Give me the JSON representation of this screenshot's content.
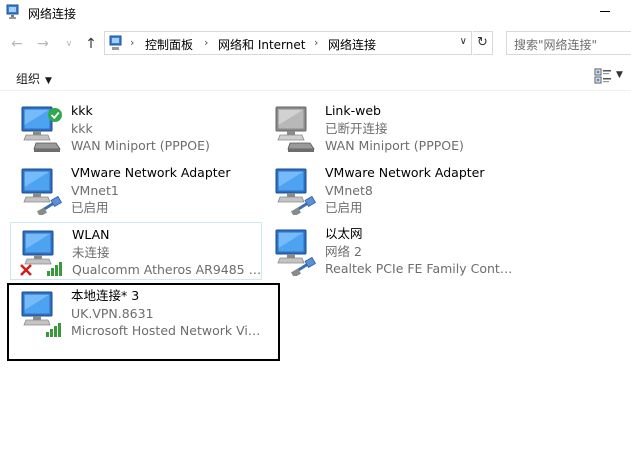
{
  "window": {
    "title": "网络连接"
  },
  "address": {
    "segments": [
      "控制面板",
      "网络和 Internet",
      "网络连接"
    ]
  },
  "search": {
    "placeholder": "搜索\"网络连接\""
  },
  "toolbar": {
    "organize_label": "组织"
  },
  "items": [
    {
      "name": "kkk",
      "line2": "kkk",
      "line3": "WAN Miniport (PPPOE)",
      "icon": "broadband-connected-icon"
    },
    {
      "name": "Link-web",
      "line2": "已断开连接",
      "line3": "WAN Miniport (PPPOE)",
      "icon": "broadband-disconnected-icon"
    },
    {
      "name": "VMware Network Adapter",
      "line2": "VMnet1",
      "line3": "已启用",
      "icon": "ethernet-adapter-icon"
    },
    {
      "name": "VMware Network Adapter",
      "line2": "VMnet8",
      "line3": "已启用",
      "icon": "ethernet-adapter-icon"
    },
    {
      "name": "WLAN",
      "line2": "未连接",
      "line3": "Qualcomm Atheros AR9485 W...",
      "icon": "wifi-disconnected-icon"
    },
    {
      "name": "以太网",
      "line2": "网络  2",
      "line3": "Realtek PCIe FE Family Control...",
      "icon": "ethernet-icon"
    },
    {
      "name": "本地连接* 3",
      "line2": "UK.VPN.8631",
      "line3": "Microsoft Hosted Network Vir...",
      "icon": "wifi-hosted-icon"
    }
  ],
  "colors": {
    "signal_green": "#3a9a3a",
    "red_x": "#d01f1f",
    "check_green": "#2fa84f",
    "hover_border": "#cde8ee"
  }
}
